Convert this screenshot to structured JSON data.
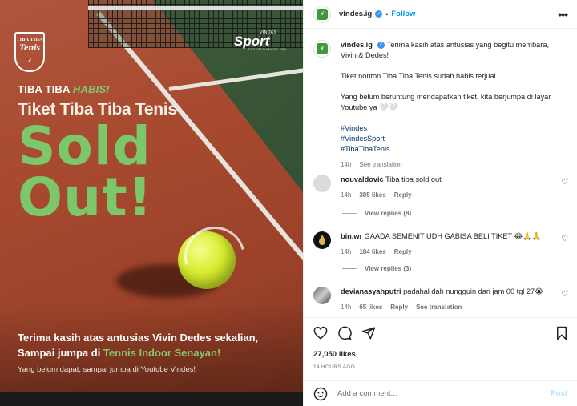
{
  "post_image": {
    "logo_left": {
      "line1": "TIBA TIBA",
      "line2": "Tenis",
      "line3": "♪"
    },
    "logo_right": {
      "line1": "VINDES",
      "line2": "Sport",
      "line3": "ENTERTAINMENT SRU"
    },
    "kicker_prefix": "TIBA TIBA ",
    "kicker_highlight": "HABIS!",
    "headline": "Tiket Tiba Tiba Tenis",
    "big_line1": "Sold",
    "big_line2": "Out!",
    "thanks_line1": "Terima kasih atas antusias Vivin Dedes sekalian,",
    "thanks_line2_prefix": "Sampai jumpa di ",
    "thanks_line2_venue": "Tennis Indoor Senayan!",
    "thanks_line3": "Yang belum dapat, sampai jumpa di Youtube Vindes!"
  },
  "header": {
    "avatar_text": "V",
    "username": "vindes.ig",
    "verified_glyph": "✓",
    "separator": "•",
    "follow_label": "Follow",
    "more_glyph": "•••"
  },
  "caption": {
    "username": "vindes.ig",
    "verified_glyph": "✓",
    "para1": "Terima kasih atas antusias yang begitu membara, Vivin & Dedes!",
    "para2": "Tiket nonton Tiba Tiba Tenis sudah habis terjual.",
    "para3": "Yang belum beruntung mendapatkan tiket, kita berjumpa di layar Youtube ya 🤍🤍",
    "hashtags": [
      "#Vindes",
      "#VindesSport",
      "#TibaTibaTenis"
    ],
    "time": "14h",
    "see_translation": "See translation"
  },
  "comments": [
    {
      "username": "nouvaldovic",
      "text": "Tiba tiba sold out",
      "time": "14h",
      "likes": "385 likes",
      "reply": "Reply",
      "view_replies": "View replies (8)"
    },
    {
      "username": "bin.wr",
      "text": "GAADA SEMENIT UDH GABISA BELI TIKET 😂🙏🙏",
      "time": "14h",
      "likes": "184 likes",
      "reply": "Reply",
      "view_replies": "View replies (3)"
    },
    {
      "username": "devianasyahputri",
      "text": "padahal dah nungguin dari jam 00 tgl 27😭",
      "time": "14h",
      "likes": "65 likes",
      "reply": "Reply",
      "see_translation": "See translation"
    }
  ],
  "footer": {
    "likes": "27,050 likes",
    "time": "14 HOURS AGO",
    "add_comment_placeholder": "Add a comment...",
    "post_label": "Post"
  },
  "colors": {
    "brand_green": "#7bc76a",
    "link_blue": "#0095f6",
    "court_red": "#a6492f"
  }
}
